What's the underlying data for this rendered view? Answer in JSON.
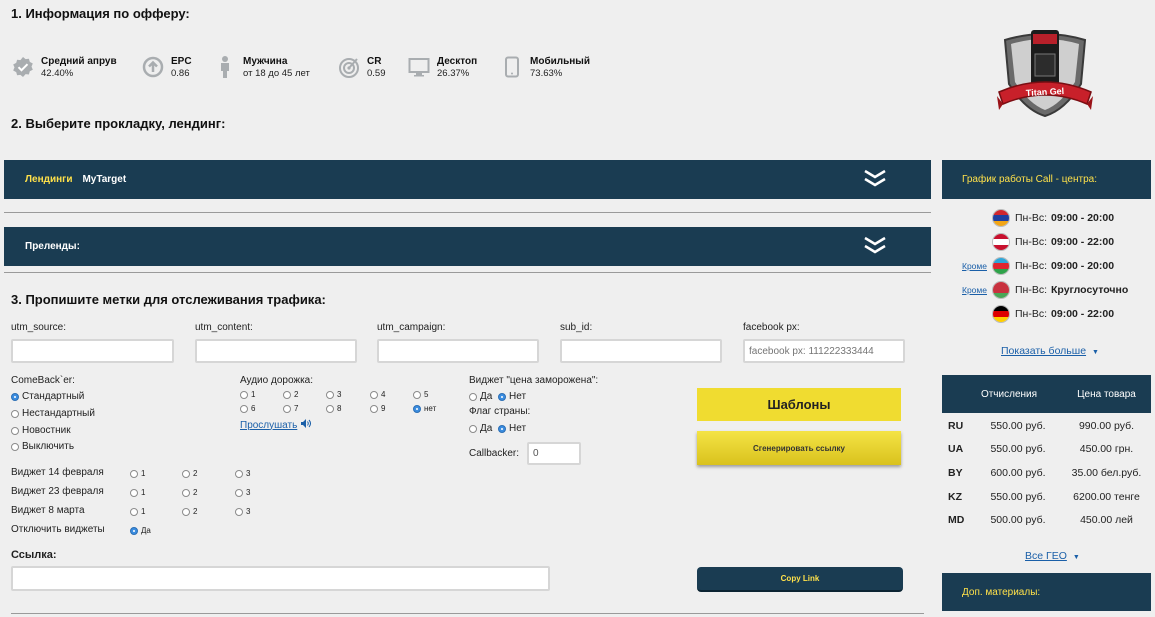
{
  "sections": {
    "s1": "1. Информация по офферу:",
    "s2": "2. Выберите прокладку, лендинг:",
    "s3": "3. Пропишите метки для отслеживания трафика:"
  },
  "stats": [
    {
      "label": "Средний апрув",
      "value": "42.40%",
      "icon": "check-badge-icon"
    },
    {
      "label": "EPC",
      "value": "0.86",
      "icon": "upload-circle-icon"
    },
    {
      "label": "Мужчина",
      "value": "от 18 до 45 лет",
      "icon": "person-icon"
    },
    {
      "label": "CR",
      "value": "0.59",
      "icon": "target-icon"
    },
    {
      "label": "Десктоп",
      "value": "26.37%",
      "icon": "monitor-icon"
    },
    {
      "label": "Мобильный",
      "value": "73.63%",
      "icon": "phone-icon"
    }
  ],
  "logo": {
    "text": "Titan Gel"
  },
  "landing_bar": {
    "tab_active": "Лендинги",
    "tab_other": "MyTarget"
  },
  "prelanding_bar": {
    "label": "Преленды:"
  },
  "utm": {
    "source_label": "utm_source:",
    "source_value": "",
    "content_label": "utm_content:",
    "content_value": "",
    "campaign_label": "utm_campaign:",
    "campaign_value": "",
    "subid_label": "sub_id:",
    "subid_value": "",
    "fb_label": "facebook px:",
    "fb_placeholder": "facebook px: 111222333444"
  },
  "comeback": {
    "label": "ComeBack`er:",
    "options": [
      "Стандартный",
      "Нестандартный",
      "Новостник",
      "Выключить"
    ],
    "selected": "Стандартный"
  },
  "audio": {
    "label": "Аудио дорожка:",
    "options": [
      "1",
      "2",
      "3",
      "4",
      "5",
      "6",
      "7",
      "8",
      "9",
      "нет"
    ],
    "selected": "нет",
    "listen": "Прослушать"
  },
  "freeze_widget": {
    "label": "Виджет \"цена заморожена\":",
    "yes": "Да",
    "no": "Нет",
    "selected": "Нет"
  },
  "flag_widget": {
    "label": "Флаг страны:",
    "yes": "Да",
    "no": "Нет",
    "selected": "Нет"
  },
  "callbacker": {
    "label": "Callbacker:",
    "value": "0"
  },
  "holiday_widgets": [
    {
      "label": "Виджет 14 февраля",
      "options": [
        "1",
        "2",
        "3"
      ]
    },
    {
      "label": "Виджет 23 февраля",
      "options": [
        "1",
        "2",
        "3"
      ]
    },
    {
      "label": "Виджет 8 марта",
      "options": [
        "1",
        "2",
        "3"
      ]
    }
  ],
  "disable_widgets": {
    "label": "Отключить виджеты",
    "option": "Да"
  },
  "link": {
    "label": "Ссылка:",
    "value": ""
  },
  "buttons": {
    "templates": "Шаблоны",
    "generate": "Сгенерировать ссылку",
    "copy": "Copy Link"
  },
  "callcenter": {
    "title": "График работы Call - центра:",
    "rows": [
      {
        "exception": "",
        "days": "Пн-Вс:",
        "hours": "09:00 - 20:00",
        "flag": [
          "#d0262e",
          "#1f3fa0",
          "#f2a516"
        ]
      },
      {
        "exception": "",
        "days": "Пн-Вс:",
        "hours": "09:00 - 22:00",
        "flag": [
          "#c8102e",
          "#ffffff",
          "#c8102e"
        ]
      },
      {
        "exception": "Кроме",
        "days": "Пн-Вс:",
        "hours": "09:00 - 20:00",
        "flag": [
          "#2fa6d8",
          "#e0252f",
          "#2fa24a"
        ]
      },
      {
        "exception": "Кроме",
        "days": "Пн-Вс:",
        "hours": "Круглосуточно",
        "flag": [
          "#c8313e",
          "#c8313e",
          "#4aa657"
        ]
      },
      {
        "exception": "",
        "days": "Пн-Вс:",
        "hours": "09:00 - 22:00",
        "flag": [
          "#000000",
          "#dd0000",
          "#ffce00"
        ]
      }
    ],
    "more": "Показать больше"
  },
  "payouts": {
    "col1": "Отчисления",
    "col2": "Цена товара",
    "rows": [
      {
        "country": "RU",
        "payout": "550.00 руб.",
        "price": "990.00 руб."
      },
      {
        "country": "UA",
        "payout": "550.00 руб.",
        "price": "450.00 грн."
      },
      {
        "country": "BY",
        "payout": "600.00 руб.",
        "price": "35.00 бел.руб."
      },
      {
        "country": "KZ",
        "payout": "550.00 руб.",
        "price": "6200.00 тенге"
      },
      {
        "country": "MD",
        "payout": "500.00 руб.",
        "price": "450.00 лей"
      }
    ],
    "all_geo": "Все ГЕО"
  },
  "extra_materials": "Доп. материалы:",
  "colors": {
    "accent_dark": "#1a3c52",
    "accent_yellow": "#ffe14a",
    "button_yellow": "#f0dc30",
    "radio_on": "#3b8de0"
  }
}
